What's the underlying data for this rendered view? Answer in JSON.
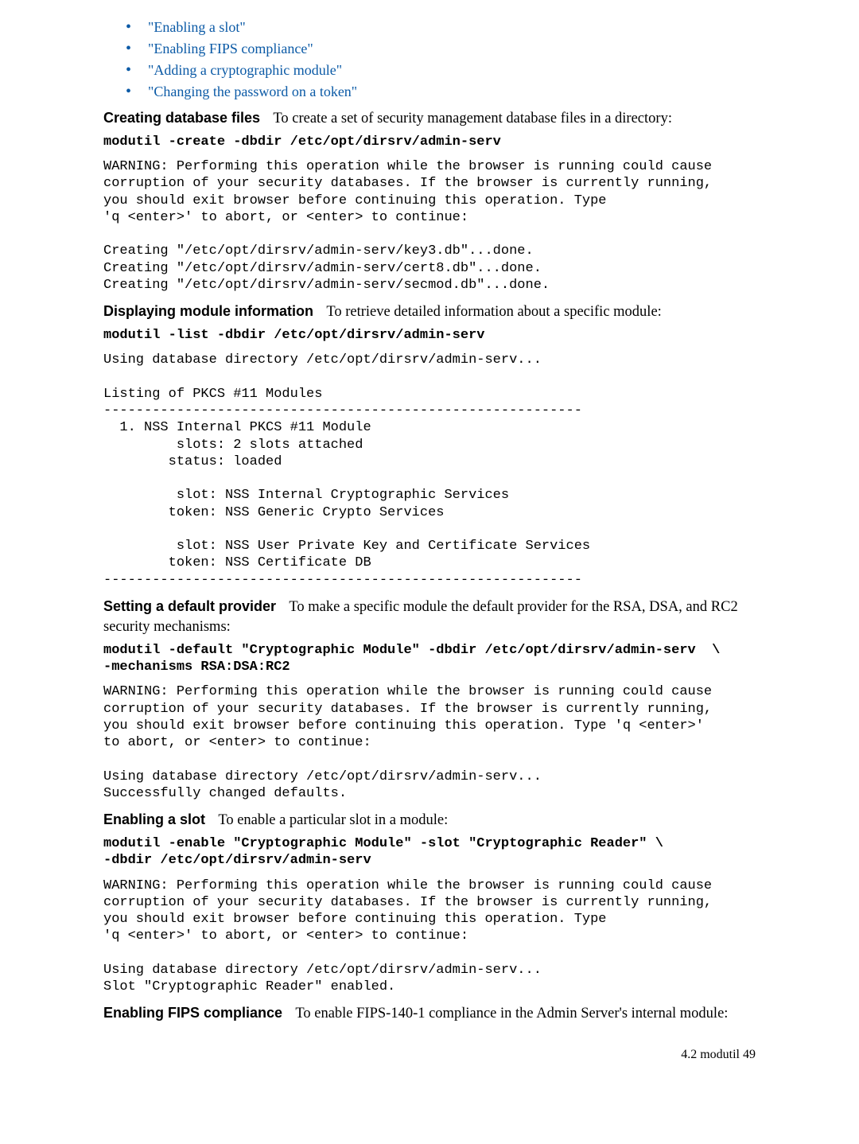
{
  "toc": {
    "items": [
      "\"Enabling a slot\"",
      "\"Enabling FIPS compliance\"",
      "\"Adding a cryptographic module\"",
      "\"Changing the password on a token\""
    ]
  },
  "s1": {
    "heading": "Creating database files",
    "intro": "To create a set of security management database files in a directory:",
    "cmd": "modutil -create -dbdir /etc/opt/dirsrv/admin-serv",
    "output": "WARNING: Performing this operation while the browser is running could cause\ncorruption of your security databases. If the browser is currently running,\nyou should exit browser before continuing this operation. Type \n'q <enter>' to abort, or <enter> to continue: \n\nCreating \"/etc/opt/dirsrv/admin-serv/key3.db\"...done.\nCreating \"/etc/opt/dirsrv/admin-serv/cert8.db\"...done.\nCreating \"/etc/opt/dirsrv/admin-serv/secmod.db\"...done."
  },
  "s2": {
    "heading": "Displaying module information",
    "intro": "To retrieve detailed information about a specific module:",
    "cmd": "modutil -list -dbdir /etc/opt/dirsrv/admin-serv",
    "output": "Using database directory /etc/opt/dirsrv/admin-serv...\n\nListing of PKCS #11 Modules\n-----------------------------------------------------------\n  1. NSS Internal PKCS #11 Module\n         slots: 2 slots attached\n        status: loaded\n\n         slot: NSS Internal Cryptographic Services\n        token: NSS Generic Crypto Services\n\n         slot: NSS User Private Key and Certificate Services\n        token: NSS Certificate DB\n-----------------------------------------------------------"
  },
  "s3": {
    "heading": "Setting a default provider",
    "intro": "To make a specific module the default provider for the RSA, DSA, and RC2 security mechanisms:",
    "cmd": "modutil -default \"Cryptographic Module\" -dbdir /etc/opt/dirsrv/admin-serv  \\\n-mechanisms RSA:DSA:RC2",
    "output": "WARNING: Performing this operation while the browser is running could cause\ncorruption of your security databases. If the browser is currently running,\nyou should exit browser before continuing this operation. Type 'q <enter>'\nto abort, or <enter> to continue: \n\nUsing database directory /etc/opt/dirsrv/admin-serv...\nSuccessfully changed defaults."
  },
  "s4": {
    "heading": "Enabling a slot",
    "intro": "To enable a particular slot in a module:",
    "cmd": "modutil -enable \"Cryptographic Module\" -slot \"Cryptographic Reader\" \\\n-dbdir /etc/opt/dirsrv/admin-serv",
    "output": "WARNING: Performing this operation while the browser is running could cause\ncorruption of your security databases. If the browser is currently running,\nyou should exit browser before continuing this operation. Type \n'q <enter>' to abort, or <enter> to continue: \n\nUsing database directory /etc/opt/dirsrv/admin-serv...\nSlot \"Cryptographic Reader\" enabled."
  },
  "s5": {
    "heading": "Enabling FIPS compliance",
    "intro": "To enable FIPS-140-1 compliance in the Admin Server's internal module:"
  },
  "footer": {
    "text": "4.2 modutil    49"
  }
}
